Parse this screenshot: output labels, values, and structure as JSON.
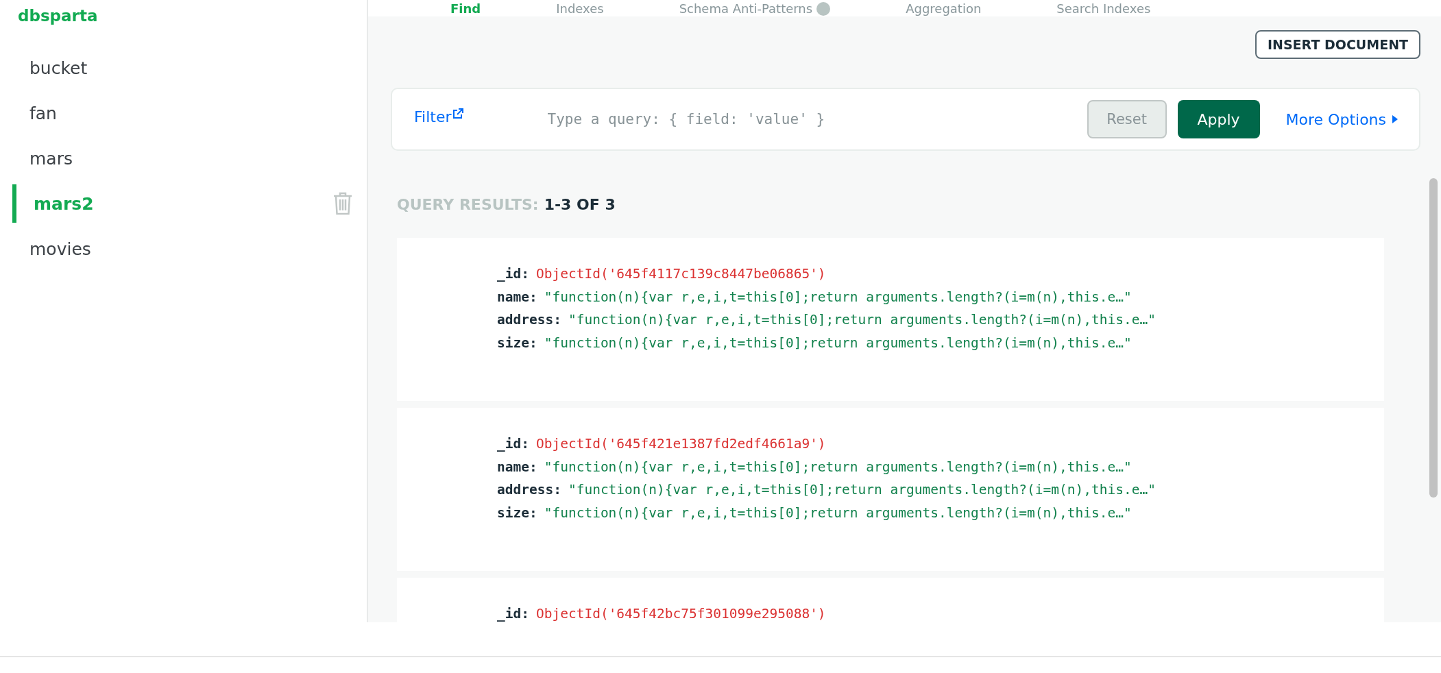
{
  "sidebar": {
    "database": "dbsparta",
    "collections": [
      {
        "name": "bucket",
        "selected": false
      },
      {
        "name": "fan",
        "selected": false
      },
      {
        "name": "mars",
        "selected": false
      },
      {
        "name": "mars2",
        "selected": true
      },
      {
        "name": "movies",
        "selected": false
      }
    ]
  },
  "tabs": [
    {
      "label": "Find",
      "selected": true
    },
    {
      "label": "Indexes",
      "selected": false
    },
    {
      "label": "Schema Anti-Patterns",
      "selected": false,
      "badge": true
    },
    {
      "label": "Aggregation",
      "selected": false
    },
    {
      "label": "Search Indexes",
      "selected": false
    }
  ],
  "insert_button": "INSERT DOCUMENT",
  "filter": {
    "label": "Filter",
    "placeholder": "Type a query: { field: 'value' }",
    "reset": "Reset",
    "apply": "Apply",
    "more": "More Options"
  },
  "results": {
    "label": "QUERY RESULTS:",
    "range": "1-3 OF 3"
  },
  "documents": [
    {
      "fields": [
        {
          "key": "_id:",
          "value": "ObjectId('645f4117c139c8447be06865')",
          "kind": "objectid"
        },
        {
          "key": "name:",
          "value": "\"function(n){var r,e,i,t=this[0];return arguments.length?(i=m(n),this.e…\"",
          "kind": "string"
        },
        {
          "key": "address:",
          "value": "\"function(n){var r,e,i,t=this[0];return arguments.length?(i=m(n),this.e…\"",
          "kind": "string"
        },
        {
          "key": "size:",
          "value": "\"function(n){var r,e,i,t=this[0];return arguments.length?(i=m(n),this.e…\"",
          "kind": "string"
        }
      ]
    },
    {
      "fields": [
        {
          "key": "_id:",
          "value": "ObjectId('645f421e1387fd2edf4661a9')",
          "kind": "objectid"
        },
        {
          "key": "name:",
          "value": "\"function(n){var r,e,i,t=this[0];return arguments.length?(i=m(n),this.e…\"",
          "kind": "string"
        },
        {
          "key": "address:",
          "value": "\"function(n){var r,e,i,t=this[0];return arguments.length?(i=m(n),this.e…\"",
          "kind": "string"
        },
        {
          "key": "size:",
          "value": "\"function(n){var r,e,i,t=this[0];return arguments.length?(i=m(n),this.e…\"",
          "kind": "string"
        }
      ]
    },
    {
      "fields": [
        {
          "key": "_id:",
          "value": "ObjectId('645f42bc75f301099e295088')",
          "kind": "objectid"
        }
      ]
    }
  ]
}
